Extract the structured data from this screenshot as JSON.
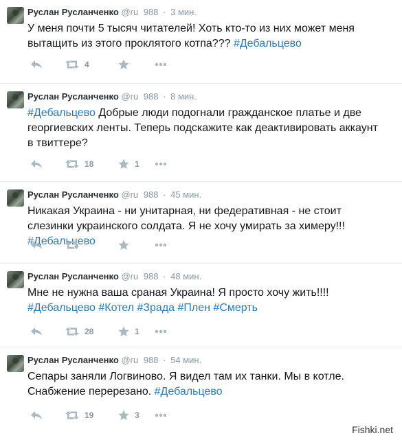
{
  "colors": {
    "accent": "#2b7bb9",
    "muted": "#8899a6",
    "icon": "#aab8c2"
  },
  "tweets": [
    {
      "name": "Руслан Русланченко",
      "handle": "@ru",
      "followers": "988",
      "time": "3 мин.",
      "text_plain": "У меня почти 5 тысяч читателей! Хоть кто-то из них  может меня вытащить из этого проклятого котпа??? ",
      "tags": [
        "#Дебальцево"
      ],
      "retweets": "4",
      "likes": ""
    },
    {
      "name": "Руслан Русланченко",
      "handle": "@ru",
      "followers": "988",
      "time": "8 мин.",
      "lead_tag": "#Дебальцево",
      "text_plain": " Добрые люди подогнали гражданское платье и две георгиевских ленты. Теперь подскажите как деактивировать аккаунт в твиттере?",
      "retweets": "18",
      "likes": "1"
    },
    {
      "name": "Руслан Русланченко",
      "handle": "@ru",
      "followers": "988",
      "time": "45 мин.",
      "text_plain": "Никакая Украина - ни унитарная, ни федеративная - не стоит слезинки украинского солдата. Я не хочу умирать за химеру!!! ",
      "tags": [
        "#Дебальцево"
      ],
      "retweets": "",
      "likes": ""
    },
    {
      "name": "Руслан Русланченко",
      "handle": "@ru",
      "followers": "988",
      "time": "48 мин.",
      "text_plain": "Мне не нужна ваша сраная Украина! Я просто хочу жить!!!!",
      "tags": [
        "#Дебальцево",
        "#Котел",
        "#Зрада",
        "#Плен",
        "#Смерть"
      ],
      "retweets": "28",
      "likes": "1"
    },
    {
      "name": "Руслан Русланченко",
      "handle": "@ru",
      "followers": "988",
      "time": "54 мин.",
      "text_plain": "Сепары заняли Логвиново. Я видел там их танки. Мы в котле. Снабжение перерезано.  ",
      "tags": [
        "#Дебальцево"
      ],
      "retweets": "19",
      "likes": "3"
    }
  ],
  "watermark": "Fishki.net"
}
